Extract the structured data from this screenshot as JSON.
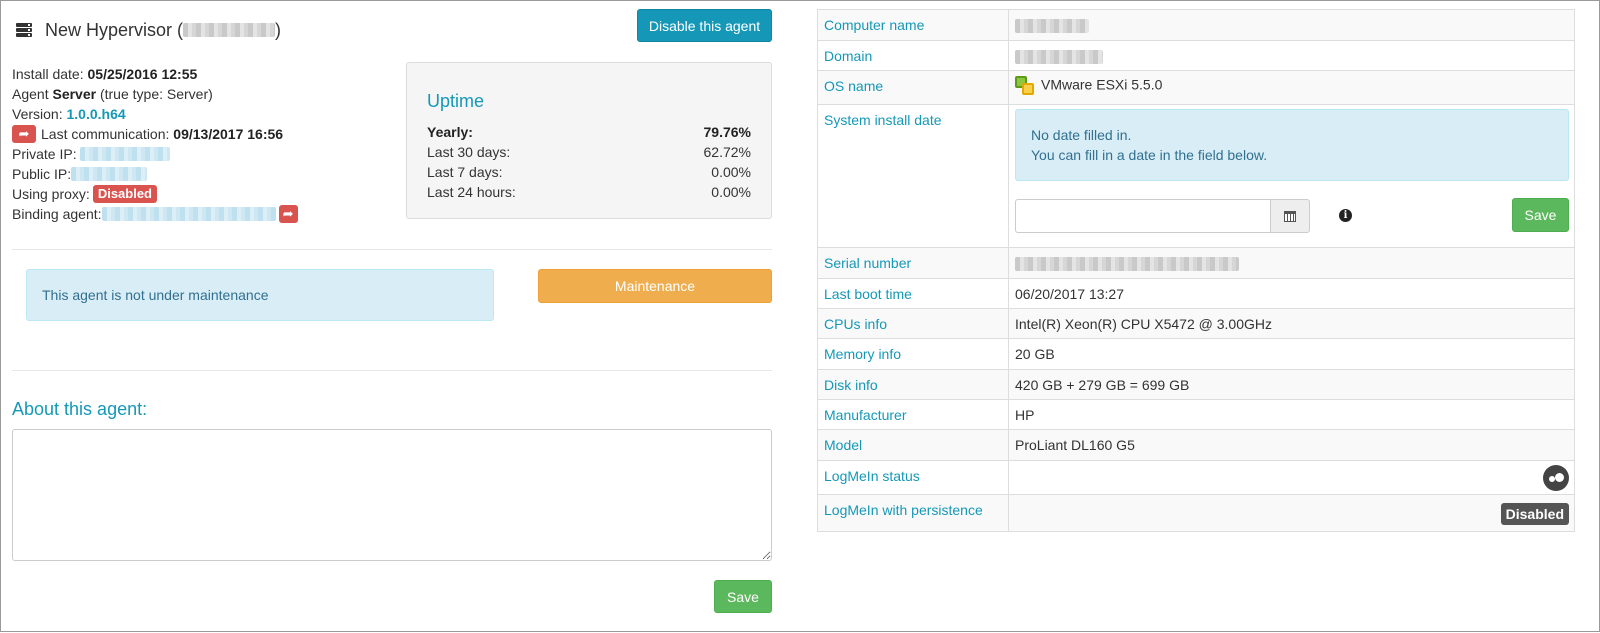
{
  "header": {
    "title_prefix": "New Hypervisor (",
    "title_suffix": ")",
    "disable_button": "Disable this agent"
  },
  "agent_info": {
    "install_date_label": "Install date:",
    "install_date": "05/25/2016 12:55",
    "agent_label": "Agent",
    "agent_type": "Server",
    "true_type": "(true type: Server)",
    "version_label": "Version:",
    "version": "1.0.0.h64",
    "last_comm_label": "Last communication:",
    "last_comm": "09/13/2017 16:56",
    "private_ip_label": "Private IP:",
    "public_ip_label": "Public IP:",
    "proxy_label": "Using proxy:",
    "proxy_status": "Disabled",
    "binding_label": "Binding agent:"
  },
  "uptime": {
    "title": "Uptime",
    "rows": [
      {
        "label": "Yearly:",
        "value": "79.76%"
      },
      {
        "label": "Last 30 days:",
        "value": "62.72%"
      },
      {
        "label": "Last 7 days:",
        "value": "0.00%"
      },
      {
        "label": "Last 24 hours:",
        "value": "0.00%"
      }
    ]
  },
  "maintenance": {
    "message": "This agent is not under maintenance",
    "button": "Maintenance"
  },
  "about": {
    "title": "About this agent:",
    "value": "",
    "save_button": "Save"
  },
  "properties": {
    "computer_name_label": "Computer name",
    "domain_label": "Domain",
    "os_name_label": "OS name",
    "os_name": "VMware ESXi 5.5.0",
    "system_install_date_label": "System install date",
    "no_date_line1": "No date filled in.",
    "no_date_line2": "You can fill in a date in the field below.",
    "date_input_value": "",
    "date_save_button": "Save",
    "serial_number_label": "Serial number",
    "last_boot_label": "Last boot time",
    "last_boot": "06/20/2017 13:27",
    "cpus_label": "CPUs info",
    "cpus": "Intel(R) Xeon(R) CPU X5472 @ 3.00GHz",
    "memory_label": "Memory info",
    "memory": "20 GB",
    "disk_label": "Disk info",
    "disk": "420 GB + 279 GB = 699 GB",
    "manufacturer_label": "Manufacturer",
    "manufacturer": "HP",
    "model_label": "Model",
    "model": "ProLiant DL160 G5",
    "logmein_status_label": "LogMeIn status",
    "logmein_persistence_label": "LogMeIn with persistence",
    "logmein_persistence": "Disabled"
  },
  "icons": {
    "title": "server-icon",
    "last_comm": "share-arrow-icon",
    "binding": "share-arrow-icon",
    "os": "vmware-icon",
    "calendar": "calendar-icon",
    "info": "info-icon",
    "logmein": "logmein-icon"
  },
  "colors": {
    "accent": "#1598b7",
    "danger": "#d9534f",
    "warning": "#f0ad4e",
    "success": "#5cb85c",
    "info_bg": "#d9edf7"
  }
}
